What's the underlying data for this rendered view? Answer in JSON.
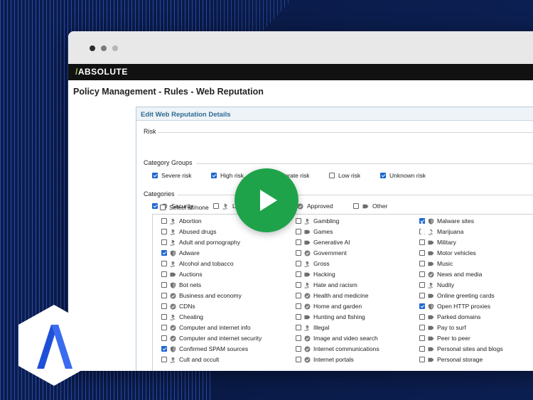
{
  "colors": {
    "background": "#0b1d4e",
    "brand_green": "#9bd43a",
    "checkbox_checked": "#1f67d1",
    "play_button": "#1fa34a",
    "panel_header_text": "#2e6a93"
  },
  "window": {
    "dots": [
      "#2b2b2b",
      "#7a7a7a",
      "#b5b5b5"
    ]
  },
  "brand": {
    "slash": "/",
    "name": "ABSOLUTE"
  },
  "page": {
    "title": "Policy Management - Rules - Web Reputation"
  },
  "panel": {
    "header": "Edit Web Reputation Details",
    "risk": {
      "legend": "Risk",
      "options": [
        {
          "label": "Severe risk",
          "checked": true
        },
        {
          "label": "High risk",
          "checked": true
        },
        {
          "label": "Moderate risk",
          "checked": false
        },
        {
          "label": "Low risk",
          "checked": false
        },
        {
          "label": "Unknown risk",
          "checked": true
        }
      ]
    },
    "groups": {
      "legend": "Category Groups",
      "options": [
        {
          "label": "Security",
          "checked": true,
          "icon": "shield-icon"
        },
        {
          "label": "Legal",
          "checked": false,
          "icon": "gavel-icon"
        },
        {
          "label": "Approved",
          "checked": false,
          "icon": "check-badge-icon"
        },
        {
          "label": "Other",
          "checked": false,
          "icon": "tag-icon"
        }
      ]
    },
    "categories": {
      "legend": "Categories",
      "select_all": "Select all/none",
      "columns": [
        [
          {
            "label": "Abortion",
            "checked": false,
            "icon": "gavel-icon"
          },
          {
            "label": "Abused drugs",
            "checked": false,
            "icon": "gavel-icon"
          },
          {
            "label": "Adult and pornography",
            "checked": false,
            "icon": "gavel-icon"
          },
          {
            "label": "Adware",
            "checked": true,
            "icon": "shield-icon"
          },
          {
            "label": "Alcohol and tobacco",
            "checked": false,
            "icon": "gavel-icon"
          },
          {
            "label": "Auctions",
            "checked": false,
            "icon": "tag-icon"
          },
          {
            "label": "Bot nets",
            "checked": false,
            "icon": "shield-icon"
          },
          {
            "label": "Business and economy",
            "checked": false,
            "icon": "check-badge-icon"
          },
          {
            "label": "CDNs",
            "checked": false,
            "icon": "check-badge-icon"
          },
          {
            "label": "Cheating",
            "checked": false,
            "icon": "gavel-icon"
          },
          {
            "label": "Computer and internet info",
            "checked": false,
            "icon": "check-badge-icon"
          },
          {
            "label": "Computer and internet security",
            "checked": false,
            "icon": "check-badge-icon"
          },
          {
            "label": "Confirmed SPAM sources",
            "checked": true,
            "icon": "shield-icon"
          },
          {
            "label": "Cult and occult",
            "checked": false,
            "icon": "gavel-icon"
          }
        ],
        [
          {
            "label": "Gambling",
            "checked": false,
            "icon": "gavel-icon"
          },
          {
            "label": "Games",
            "checked": false,
            "icon": "tag-icon"
          },
          {
            "label": "Generative AI",
            "checked": false,
            "icon": "tag-icon"
          },
          {
            "label": "Government",
            "checked": false,
            "icon": "check-badge-icon"
          },
          {
            "label": "Gross",
            "checked": false,
            "icon": "gavel-icon"
          },
          {
            "label": "Hacking",
            "checked": false,
            "icon": "tag-icon"
          },
          {
            "label": "Hate and racism",
            "checked": false,
            "icon": "gavel-icon"
          },
          {
            "label": "Health and medicine",
            "checked": false,
            "icon": "check-badge-icon"
          },
          {
            "label": "Home and garden",
            "checked": false,
            "icon": "check-badge-icon"
          },
          {
            "label": "Hunting and fishing",
            "checked": false,
            "icon": "tag-icon"
          },
          {
            "label": "Illegal",
            "checked": false,
            "icon": "gavel-icon"
          },
          {
            "label": "Image and video search",
            "checked": false,
            "icon": "check-badge-icon"
          },
          {
            "label": "Internet communications",
            "checked": false,
            "icon": "check-badge-icon"
          },
          {
            "label": "Internet portals",
            "checked": false,
            "icon": "check-badge-icon"
          }
        ],
        [
          {
            "label": "Malware sites",
            "checked": true,
            "icon": "shield-icon"
          },
          {
            "label": "Marijuana",
            "checked": false,
            "icon": "gavel-icon"
          },
          {
            "label": "Military",
            "checked": false,
            "icon": "tag-icon"
          },
          {
            "label": "Motor vehicles",
            "checked": false,
            "icon": "tag-icon"
          },
          {
            "label": "Music",
            "checked": false,
            "icon": "tag-icon"
          },
          {
            "label": "News and media",
            "checked": false,
            "icon": "check-badge-icon"
          },
          {
            "label": "Nudity",
            "checked": false,
            "icon": "gavel-icon"
          },
          {
            "label": "Online greeting cards",
            "checked": false,
            "icon": "tag-icon"
          },
          {
            "label": "Open HTTP proxies",
            "checked": true,
            "icon": "shield-icon"
          },
          {
            "label": "Parked domains",
            "checked": false,
            "icon": "tag-icon"
          },
          {
            "label": "Pay to surf",
            "checked": false,
            "icon": "tag-icon"
          },
          {
            "label": "Peer to peer",
            "checked": false,
            "icon": "tag-icon"
          },
          {
            "label": "Personal sites and blogs",
            "checked": false,
            "icon": "tag-icon"
          },
          {
            "label": "Personal storage",
            "checked": false,
            "icon": "tag-icon"
          }
        ]
      ]
    }
  }
}
